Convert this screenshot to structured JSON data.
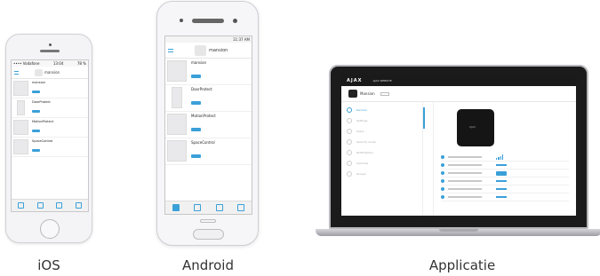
{
  "captions": {
    "ios": "iOS",
    "android": "Android",
    "app": "Applicatie"
  },
  "ios_app": {
    "status_left": "•••• Vodafone",
    "status_time": "13:04",
    "status_right": "78 %",
    "hub_name": "mansion",
    "devices": [
      "mansion",
      "DoorProtect",
      "MotionProtect",
      "SpaceControl"
    ]
  },
  "android_app": {
    "status_time": "11:37 AM",
    "hub_name": "mansion",
    "devices": [
      "mansion",
      "DoorProtect",
      "MotionProtect",
      "SpaceControl"
    ]
  },
  "web_app": {
    "logo": "AJAX",
    "nav": "AJAX WEBSITE",
    "hub_name": "Mansion",
    "hub_label": "AJAX",
    "sidebar": [
      "Devices",
      "Settings",
      "Users",
      "Security mode",
      "Notifications",
      "Cameras",
      "Groups"
    ]
  },
  "colors": {
    "accent": "#3aa0d8",
    "hub_black": "#151515"
  }
}
